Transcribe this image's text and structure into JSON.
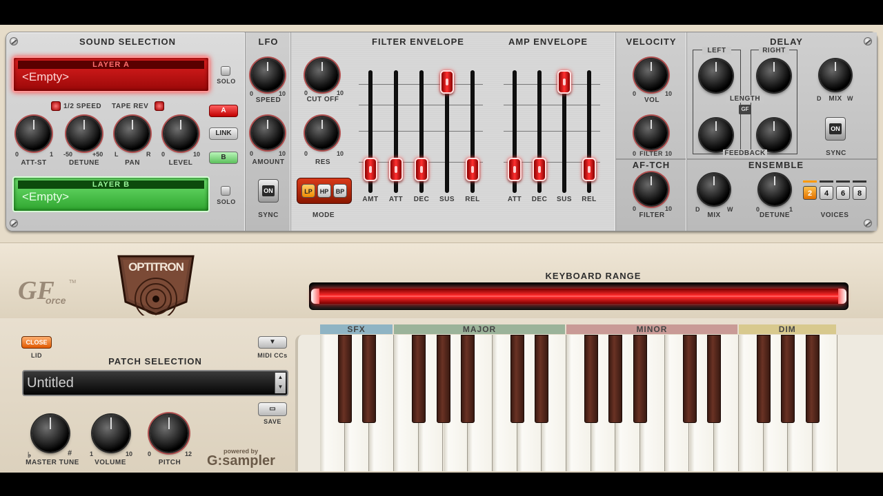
{
  "sound_selection": {
    "title": "SOUND SELECTION",
    "layer_a": {
      "title": "LAYER A",
      "value": "<Empty>",
      "solo": "SOLO"
    },
    "layer_b": {
      "title": "LAYER B",
      "value": "<Empty>",
      "solo": "SOLO"
    },
    "half_speed": "1/2 SPEED",
    "tape_rev": "TAPE REV",
    "btn_a": "A",
    "btn_link": "LINK",
    "btn_b": "B",
    "knobs": [
      {
        "label": "ATT-ST",
        "min": "0",
        "max": "1"
      },
      {
        "label": "DETUNE",
        "min": "-50",
        "max": "+50"
      },
      {
        "label": "PAN",
        "min": "L",
        "max": "R"
      },
      {
        "label": "LEVEL",
        "min": "0",
        "max": "10"
      }
    ]
  },
  "lfo": {
    "title": "LFO",
    "speed": {
      "label": "SPEED",
      "min": "0",
      "max": "10"
    },
    "amount": {
      "label": "AMOUNT",
      "min": "0",
      "max": "10"
    },
    "sync": {
      "label": "SYNC",
      "button": "ON"
    }
  },
  "filter": {
    "cutoff": {
      "label": "CUT OFF",
      "min": "0",
      "max": "10"
    },
    "res": {
      "label": "RES",
      "min": "0",
      "max": "10"
    },
    "mode": {
      "label": "MODE",
      "options": [
        "LP",
        "HP",
        "BP"
      ],
      "selected": "LP"
    }
  },
  "filter_envelope": {
    "title": "FILTER ENVELOPE",
    "faders": [
      {
        "label": "AMT",
        "level": 0.12
      },
      {
        "label": "ATT",
        "level": 0.12
      },
      {
        "label": "DEC",
        "level": 0.12
      },
      {
        "label": "SUS",
        "level": 1.0
      },
      {
        "label": "REL",
        "level": 0.12
      }
    ]
  },
  "amp_envelope": {
    "title": "AMP ENVELOPE",
    "faders": [
      {
        "label": "ATT",
        "level": 0.12
      },
      {
        "label": "DEC",
        "level": 0.12
      },
      {
        "label": "SUS",
        "level": 1.0
      },
      {
        "label": "REL",
        "level": 0.12
      }
    ]
  },
  "velocity": {
    "title": "VELOCITY",
    "vol": {
      "label": "VOL",
      "min": "0",
      "max": "10"
    },
    "filter": {
      "label": "FILTER",
      "min": "0",
      "max": "10"
    }
  },
  "aftertouch": {
    "title": "AF-TCH",
    "filter": {
      "label": "FILTER",
      "min": "0",
      "max": "10"
    }
  },
  "delay": {
    "title": "DELAY",
    "left": "LEFT",
    "right": "RIGHT",
    "length": "LENGTH",
    "feedback": "FEEDBACK",
    "mix": {
      "label": "MIX",
      "min": "D",
      "max": "W"
    },
    "sync": {
      "label": "SYNC",
      "button": "ON"
    },
    "gf_badge": "GF"
  },
  "ensemble": {
    "title": "ENSEMBLE",
    "mix": {
      "label": "MIX",
      "min": "D",
      "max": "W"
    },
    "detune": {
      "label": "DETUNE",
      "min": "0",
      "max": "1"
    },
    "voices": {
      "label": "VOICES",
      "options": [
        "2",
        "4",
        "6",
        "8"
      ],
      "selected": "2"
    }
  },
  "keyboard_range": {
    "title": "KEYBOARD RANGE"
  },
  "brand": {
    "gforce": "GF",
    "gforce_sub": "orce",
    "tm": "TM",
    "product": "OPTITRON",
    "powered_by": "powered by",
    "gsampler": "G:sampler"
  },
  "patch": {
    "close_btn": "CLOSE",
    "lid": "LID",
    "midi_ccs": "MIDI CCs",
    "title": "PATCH SELECTION",
    "name": "Untitled",
    "save": "SAVE",
    "master_tune": {
      "label": "MASTER TUNE",
      "min": "♭",
      "max": "#"
    },
    "volume": {
      "label": "VOLUME",
      "min": "1",
      "max": "10"
    },
    "pitch": {
      "label": "PITCH",
      "min": "0",
      "max": "12"
    }
  },
  "keyboard": {
    "categories": [
      {
        "name": "SFX",
        "color": "#8fb4c4"
      },
      {
        "name": "MAJOR",
        "color": "#9bb39a"
      },
      {
        "name": "MINOR",
        "color": "#c99a96"
      },
      {
        "name": "DIM",
        "color": "#d8c98e"
      }
    ],
    "white_keys": 21
  },
  "colors": {
    "accent_red": "#e02020",
    "layer_b_green": "#4fc44f",
    "panel": "#d0d0d0"
  }
}
